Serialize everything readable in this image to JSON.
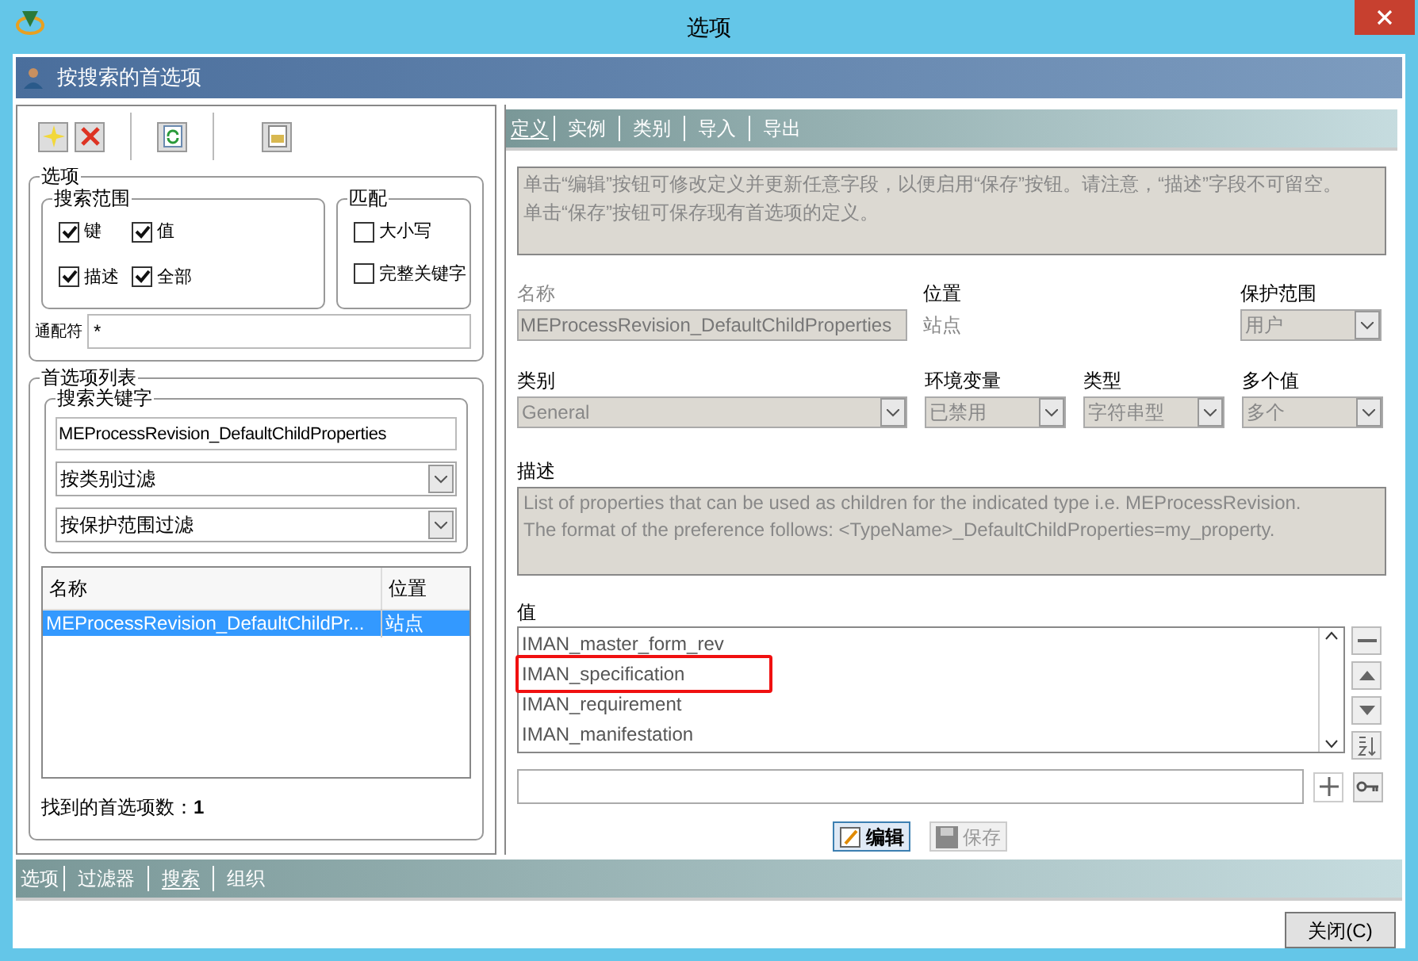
{
  "window": {
    "title": "选项"
  },
  "header": {
    "title": "按搜索的首选项"
  },
  "options_group": {
    "title": "选项",
    "search_scope": {
      "title": "搜索范围",
      "checkboxes": [
        {
          "label": "键",
          "checked": true
        },
        {
          "label": "值",
          "checked": true
        },
        {
          "label": "描述",
          "checked": true
        },
        {
          "label": "全部",
          "checked": true
        }
      ]
    },
    "match": {
      "title": "匹配",
      "checkboxes": [
        {
          "label": "大小写",
          "checked": false
        },
        {
          "label": "完整关键字",
          "checked": false
        }
      ]
    },
    "wildcard": {
      "label": "通配符",
      "value": "*"
    }
  },
  "preference_list": {
    "title": "首选项列表",
    "search_keyword": {
      "title": "搜索关键字",
      "value": "MEProcessRevision_DefaultChildProperties"
    },
    "filters": [
      {
        "value": "按类别过滤"
      },
      {
        "value": "按保护范围过滤"
      }
    ],
    "table": {
      "columns": [
        "名称",
        "位置"
      ],
      "rows": [
        {
          "cells": [
            "MEProcessRevision_DefaultChildPr...",
            "站点"
          ],
          "selected": true
        }
      ]
    },
    "found": "找到的首选项数：**1**"
  },
  "left_tabs": [
    {
      "label": "选项",
      "selected": false
    },
    {
      "label": "过滤器",
      "selected": false
    },
    {
      "label": "搜索",
      "selected": true
    },
    {
      "label": "组织",
      "selected": false
    }
  ],
  "right_tabs": [
    {
      "label": "定义",
      "selected": true
    },
    {
      "label": "实例",
      "selected": false
    },
    {
      "label": "类别",
      "selected": false
    },
    {
      "label": "导入",
      "selected": false
    },
    {
      "label": "导出",
      "selected": false
    }
  ],
  "info_lines": [
    "单击“编辑”按钮可修改定义并更新任意字段，以便启用“保存”按钮。请注意，“描述”字段不可留空。",
    "单击“保存”按钮可保存现有首选项的定义。"
  ],
  "name": {
    "label": "名称",
    "value": "MEProcessRevision_DefaultChildProperties"
  },
  "location": {
    "label": "位置",
    "value": "站点"
  },
  "protection": {
    "label": "保护范围",
    "value": "用户"
  },
  "category": {
    "label": "类别",
    "value": "General"
  },
  "env_var": {
    "label": "环境变量",
    "value": "已禁用"
  },
  "type": {
    "label": "类型",
    "value": "字符串型"
  },
  "multiple": {
    "label": "多个值",
    "value": "多个"
  },
  "description": {
    "label": "描述",
    "lines": [
      "List of properties that can be used as children for the indicated type i.e. MEProcessRevision.",
      "The format of the preference follows: <TypeName>_DefaultChildProperties=my_property."
    ]
  },
  "values": {
    "label": "值",
    "items": [
      {
        "text": "IMAN_master_form_rev",
        "highlighted": false
      },
      {
        "text": "IMAN_specification",
        "highlighted": true
      },
      {
        "text": "IMAN_requirement",
        "highlighted": false
      },
      {
        "text": "IMAN_manifestation",
        "highlighted": false
      }
    ]
  },
  "buttons": [
    {
      "label": "编辑",
      "disabled": false
    },
    {
      "label": "保存",
      "disabled": true
    }
  ],
  "close_button": {
    "label": "关闭(C)"
  }
}
